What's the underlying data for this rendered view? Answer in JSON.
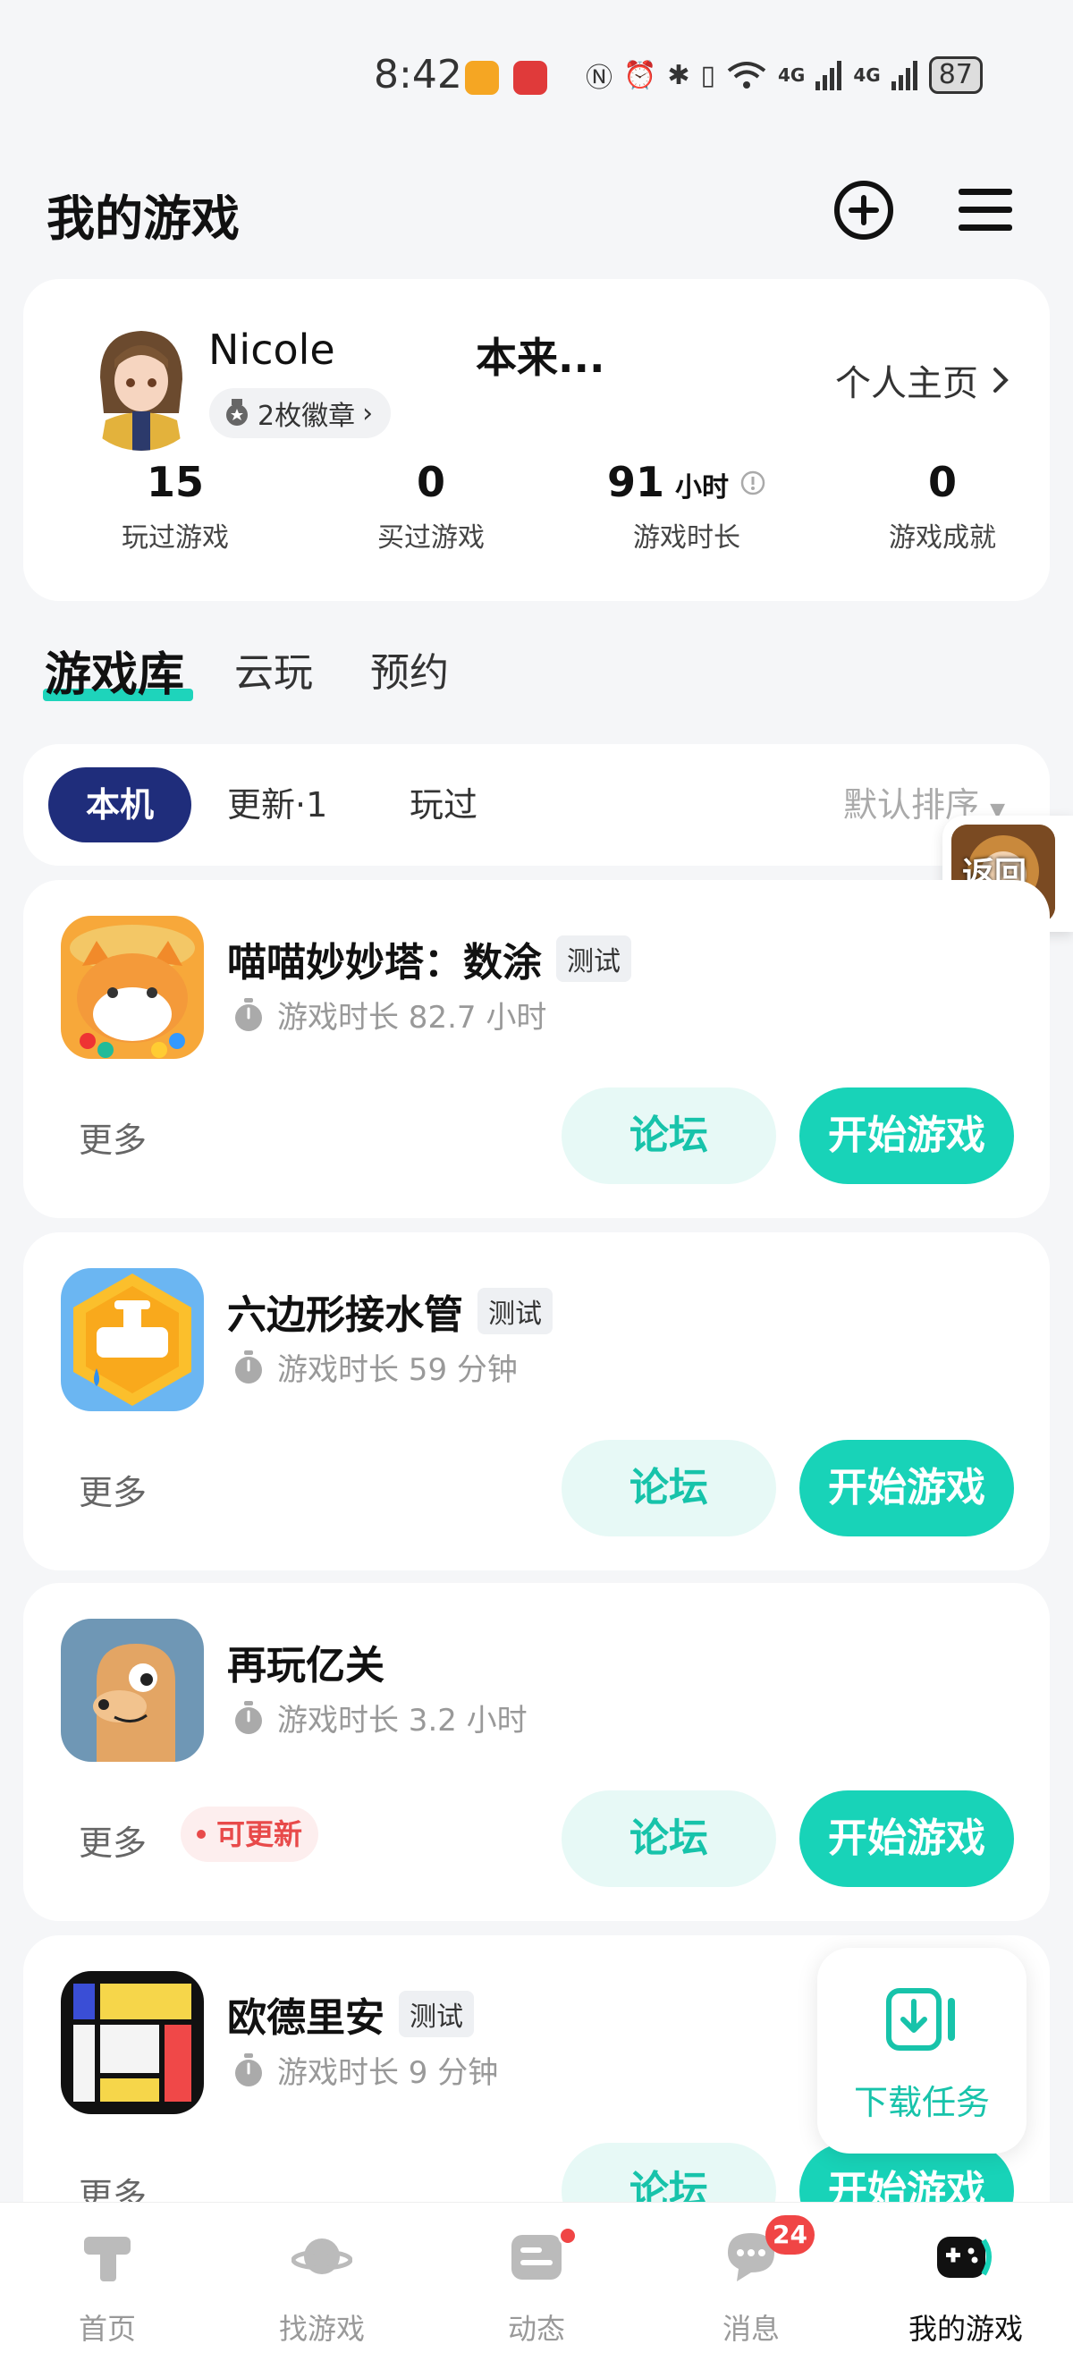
{
  "status_bar": {
    "time": "8:42",
    "network": "4G",
    "network2": "4G",
    "battery": "87"
  },
  "header": {
    "title": "我的游戏"
  },
  "profile": {
    "username": "Nicole",
    "nickname": "本来...",
    "badge_text": "2枚徽章",
    "homepage_link": "个人主页",
    "stats": [
      {
        "value": "15",
        "unit": "",
        "label": "玩过游戏"
      },
      {
        "value": "0",
        "unit": "",
        "label": "买过游戏"
      },
      {
        "value": "91",
        "unit": "小时",
        "label": "游戏时长"
      },
      {
        "value": "0",
        "unit": "",
        "label": "游戏成就"
      }
    ]
  },
  "tabs": [
    {
      "label": "游戏库"
    },
    {
      "label": "云玩"
    },
    {
      "label": "预约"
    }
  ],
  "filters": {
    "chips": [
      "本机",
      "更新·1",
      "玩过"
    ],
    "sort_label": "默认排序"
  },
  "floating_back": {
    "label": "返回"
  },
  "games": [
    {
      "name": "喵喵妙妙塔：数涂",
      "tag": "测试",
      "playtime": "游戏时长 82.7 小时",
      "more": "更多",
      "update": "",
      "forum": "论坛",
      "start": "开始游戏"
    },
    {
      "name": "六边形接水管",
      "tag": "测试",
      "playtime": "游戏时长 59 分钟",
      "more": "更多",
      "update": "",
      "forum": "论坛",
      "start": "开始游戏"
    },
    {
      "name": "再玩亿关",
      "tag": "",
      "playtime": "游戏时长 3.2 小时",
      "more": "更多",
      "update": "可更新",
      "forum": "论坛",
      "start": "开始游戏"
    },
    {
      "name": "欧德里安",
      "tag": "测试",
      "playtime": "游戏时长 9 分钟",
      "more": "更多",
      "update": "",
      "forum": "论坛",
      "start": "开始游戏"
    }
  ],
  "download_task": {
    "label": "下载任务"
  },
  "bottom_nav": [
    {
      "label": "首页",
      "icon": "home-icon"
    },
    {
      "label": "找游戏",
      "icon": "planet-icon"
    },
    {
      "label": "动态",
      "icon": "feed-icon"
    },
    {
      "label": "消息",
      "icon": "message-icon",
      "badge": "24"
    },
    {
      "label": "我的游戏",
      "icon": "gamepad-icon"
    }
  ],
  "colors": {
    "accent": "#18d3b8",
    "primary_chip": "#1f2d7b",
    "badge_red": "#f04545"
  }
}
